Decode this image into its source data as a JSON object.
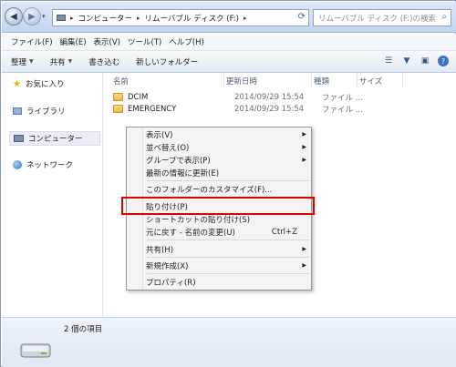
{
  "titlebar": {
    "breadcrumb": [
      "コンピューター",
      "リムーバブル ディスク (F:)"
    ],
    "search_placeholder": "リムーバブル ディスク (F:)の検索"
  },
  "menubar": [
    "ファイル(F)",
    "編集(E)",
    "表示(V)",
    "ツール(T)",
    "ヘルプ(H)"
  ],
  "toolbar": {
    "organize": "整理",
    "share": "共有",
    "burn": "書き込む",
    "new_folder": "新しいフォルダー"
  },
  "nav": {
    "favorites": "お気に入り",
    "libraries": "ライブラリ",
    "computer": "コンピューター",
    "network": "ネットワーク"
  },
  "columns": {
    "name": "名前",
    "date": "更新日時",
    "type": "種類",
    "size": "サイズ"
  },
  "files": [
    {
      "name": "DCIM",
      "date": "2014/09/29 15:54",
      "type": "ファイル ..."
    },
    {
      "name": "EMERGENCY",
      "date": "2014/09/29 15:54",
      "type": "ファイル ..."
    }
  ],
  "context_menu": {
    "view": "表示(V)",
    "sort": "並べ替え(O)",
    "group": "グループで表示(P)",
    "refresh": "最新の情報に更新(E)",
    "customize": "このフォルダーのカスタマイズ(F)...",
    "paste": "貼り付け(P)",
    "paste_shortcut": "ショートカットの貼り付け(S)",
    "undo": "元に戻す - 名前の変更(U)",
    "undo_shortcut": "Ctrl+Z",
    "share": "共有(H)",
    "new": "新規作成(X)",
    "properties": "プロパティ(R)"
  },
  "status": {
    "count": "2 個の項目"
  },
  "colors": {
    "highlight": "#e00000",
    "selection": "#e9eef6"
  }
}
